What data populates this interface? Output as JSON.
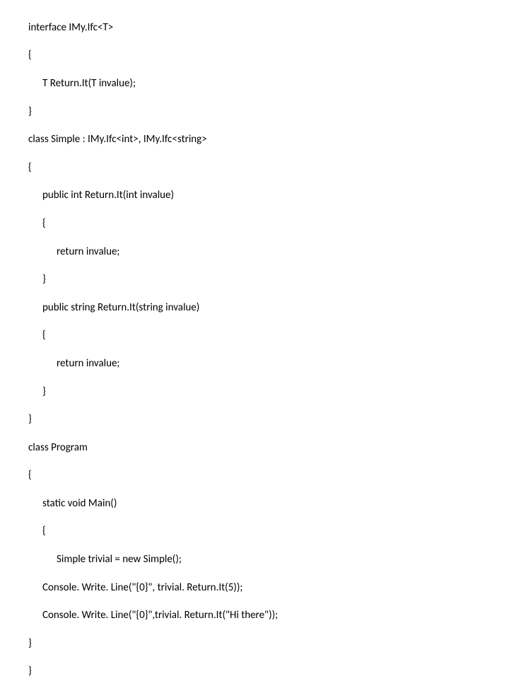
{
  "code": {
    "l1": "interface IMy.Ifc<T>",
    "l2": "{",
    "l3": "T Return.It(T invalue);",
    "l4": "}",
    "l5": "class Simple : IMy.Ifc<int>, IMy.Ifc<string>",
    "l6": "{",
    "l7": "public int Return.It(int invalue)",
    "l8": "{",
    "l9": "return invalue;",
    "l10": "}",
    "l11": "public string Return.It(string invalue)",
    "l12": "{",
    "l13": "return invalue;",
    "l14": "}",
    "l15": "}",
    "l16": "class Program",
    "l17": "{",
    "l18": "static void Main()",
    "l19": "{",
    "l20": "Simple trivial = new Simple();",
    "l21": "Console. Write. Line(\"{0}\", trivial. Return.It(5));",
    "l22": "Console. Write. Line(\"{0}\",trivial. Return.It(\"Hi there\"));",
    "l23": "}",
    "l24": "}"
  }
}
